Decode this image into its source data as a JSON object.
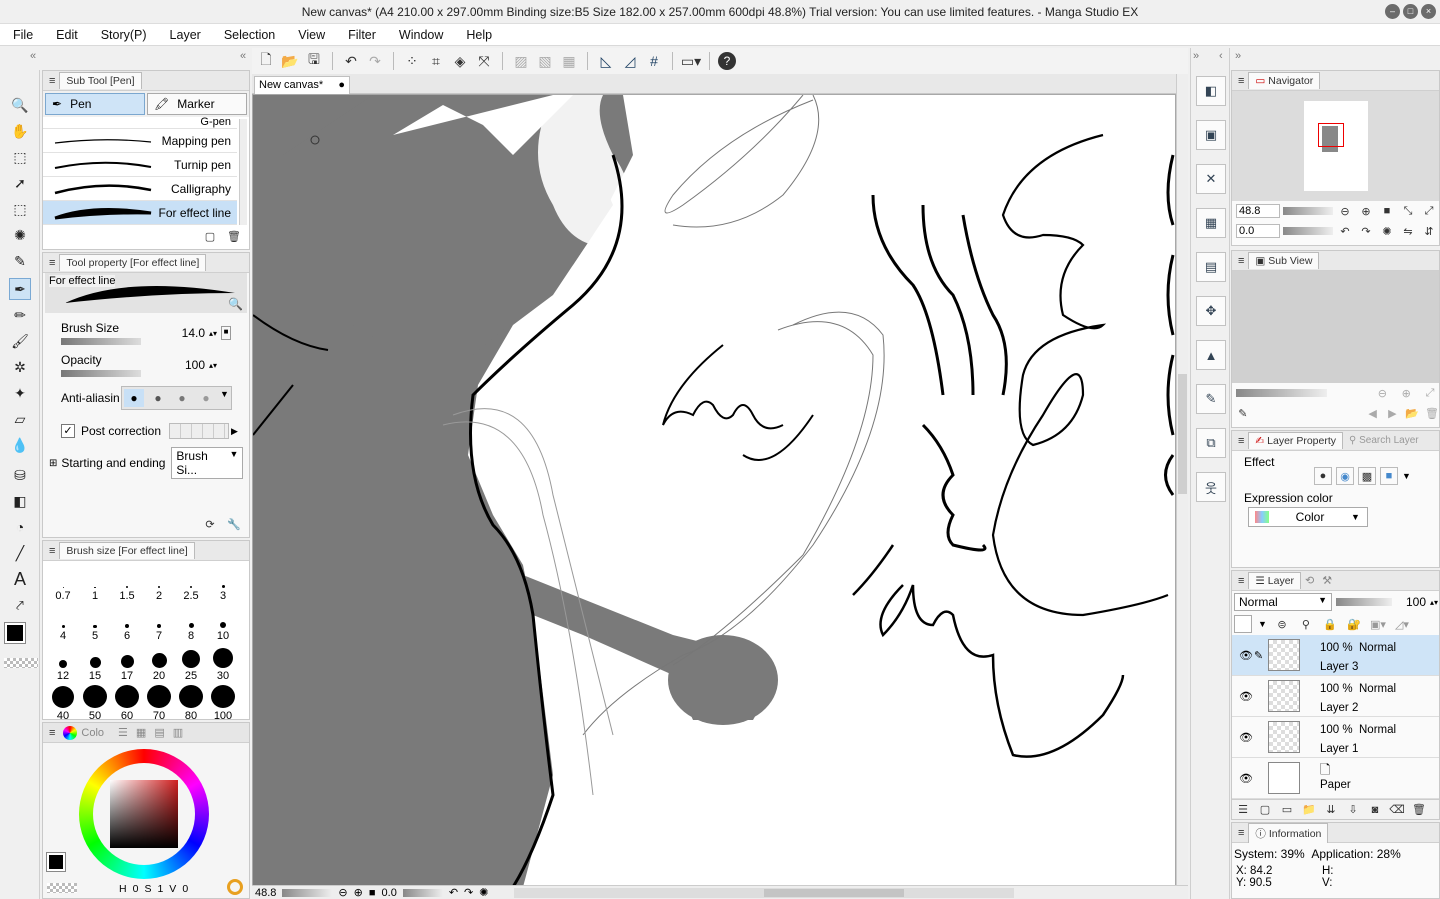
{
  "window": {
    "title": "New canvas* (A4 210.00 x 297.00mm Binding size:B5 Size 182.00 x 257.00mm 600dpi 48.8%)  Trial version: You can use limited features. - Manga Studio EX"
  },
  "menu": [
    "File",
    "Edit",
    "Story(P)",
    "Layer",
    "Selection",
    "View",
    "Filter",
    "Window",
    "Help"
  ],
  "subtool": {
    "title": "Sub Tool [Pen]",
    "tabs": [
      "Pen",
      "Marker"
    ],
    "brushes": [
      "G-pen",
      "Mapping pen",
      "Turnip pen",
      "Calligraphy",
      "For effect line"
    ],
    "selected_brush": "For effect line"
  },
  "toolprop": {
    "title": "Tool property [For effect line]",
    "preview_label": "For effect line",
    "brush_size_label": "Brush Size",
    "brush_size_value": "14.0",
    "opacity_label": "Opacity",
    "opacity_value": "100",
    "antialias_label": "Anti-aliasin",
    "post_correction_label": "Post correction",
    "start_end_label": "Starting and ending",
    "start_end_value": "Brush Si..."
  },
  "brushsize": {
    "title": "Brush size [For effect line]",
    "sizes": [
      "0.7",
      "1",
      "1.5",
      "2",
      "2.5",
      "3",
      "4",
      "5",
      "6",
      "7",
      "8",
      "10",
      "12",
      "15",
      "17",
      "20",
      "25",
      "30",
      "40",
      "50",
      "60",
      "70",
      "80",
      "100"
    ]
  },
  "color": {
    "tab_label": "Colo",
    "fg": "#000000",
    "values": [
      "0",
      "1",
      "0"
    ],
    "accent": "#d02020"
  },
  "canvas": {
    "tab_label": "New canvas*",
    "zoom": "48.8",
    "angle": "0.0"
  },
  "navigator": {
    "title": "Navigator",
    "zoom": "48.8",
    "angle": "0.0"
  },
  "subview": {
    "title": "Sub View"
  },
  "layerprop": {
    "title": "Layer Property",
    "search_tab": "Search Layer",
    "effect_label": "Effect",
    "expression_label": "Expression color",
    "expression_value": "Color"
  },
  "layers": {
    "title": "Layer",
    "blend": "Normal",
    "opacity": "100",
    "items": [
      {
        "pct": "100 %",
        "mode": "Normal",
        "name": "Layer 3"
      },
      {
        "pct": "100 %",
        "mode": "Normal",
        "name": "Layer 2"
      },
      {
        "pct": "100 %",
        "mode": "Normal",
        "name": "Layer 1"
      },
      {
        "pct": "",
        "mode": "",
        "name": "Paper"
      }
    ]
  },
  "info": {
    "title": "Information",
    "system": "System: 39%",
    "application": "Application: 28%",
    "x": "X: 84.2",
    "y": "Y: 90.5",
    "h": "H:",
    "v": "V:"
  }
}
